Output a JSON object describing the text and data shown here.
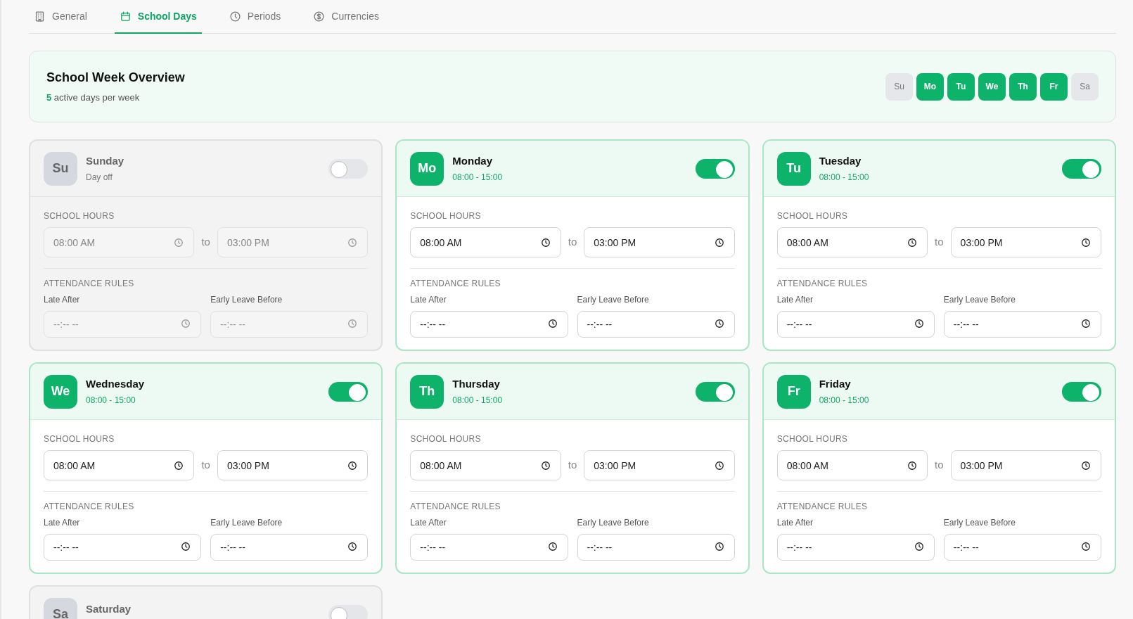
{
  "tabs": [
    {
      "label": "General",
      "selected": false
    },
    {
      "label": "School Days",
      "selected": true
    },
    {
      "label": "Periods",
      "selected": false
    },
    {
      "label": "Currencies",
      "selected": false
    }
  ],
  "overview": {
    "title": "School Week Overview",
    "count": "5",
    "summary": "active days per week",
    "days": [
      {
        "label": "Su",
        "active": false
      },
      {
        "label": "Mo",
        "active": true
      },
      {
        "label": "Tu",
        "active": true
      },
      {
        "label": "We",
        "active": true
      },
      {
        "label": "Th",
        "active": true
      },
      {
        "label": "Fr",
        "active": true
      },
      {
        "label": "Sa",
        "active": false
      }
    ]
  },
  "days": [
    {
      "abbr": "Su",
      "name": "Sunday",
      "subtitle": "Day off",
      "on": false,
      "hours_label": "SCHOOL HOURS",
      "start": "08:00 AM",
      "to": "to",
      "end": "03:00 PM",
      "rules_label": "ATTENDANCE RULES",
      "late_label": "Late After",
      "late_placeholder": "--:-- --",
      "early_label": "Early Leave Before",
      "early_placeholder": "--:-- --"
    },
    {
      "abbr": "Mo",
      "name": "Monday",
      "subtitle": "08:00 - 15:00",
      "on": true,
      "hours_label": "SCHOOL HOURS",
      "start": "08:00 AM",
      "to": "to",
      "end": "03:00 PM",
      "rules_label": "ATTENDANCE RULES",
      "late_label": "Late After",
      "late_placeholder": "--:-- --",
      "early_label": "Early Leave Before",
      "early_placeholder": "--:-- --"
    },
    {
      "abbr": "Tu",
      "name": "Tuesday",
      "subtitle": "08:00 - 15:00",
      "on": true,
      "hours_label": "SCHOOL HOURS",
      "start": "08:00 AM",
      "to": "to",
      "end": "03:00 PM",
      "rules_label": "ATTENDANCE RULES",
      "late_label": "Late After",
      "late_placeholder": "--:-- --",
      "early_label": "Early Leave Before",
      "early_placeholder": "--:-- --"
    },
    {
      "abbr": "We",
      "name": "Wednesday",
      "subtitle": "08:00 - 15:00",
      "on": true,
      "hours_label": "SCHOOL HOURS",
      "start": "08:00 AM",
      "to": "to",
      "end": "03:00 PM",
      "rules_label": "ATTENDANCE RULES",
      "late_label": "Late After",
      "late_placeholder": "--:-- --",
      "early_label": "Early Leave Before",
      "early_placeholder": "--:-- --"
    },
    {
      "abbr": "Th",
      "name": "Thursday",
      "subtitle": "08:00 - 15:00",
      "on": true,
      "hours_label": "SCHOOL HOURS",
      "start": "08:00 AM",
      "to": "to",
      "end": "03:00 PM",
      "rules_label": "ATTENDANCE RULES",
      "late_label": "Late After",
      "late_placeholder": "--:-- --",
      "early_label": "Early Leave Before",
      "early_placeholder": "--:-- --"
    },
    {
      "abbr": "Fr",
      "name": "Friday",
      "subtitle": "08:00 - 15:00",
      "on": true,
      "hours_label": "SCHOOL HOURS",
      "start": "08:00 AM",
      "to": "to",
      "end": "03:00 PM",
      "rules_label": "ATTENDANCE RULES",
      "late_label": "Late After",
      "late_placeholder": "--:-- --",
      "early_label": "Early Leave Before",
      "early_placeholder": "--:-- --"
    },
    {
      "abbr": "Sa",
      "name": "Saturday",
      "on": false
    }
  ]
}
